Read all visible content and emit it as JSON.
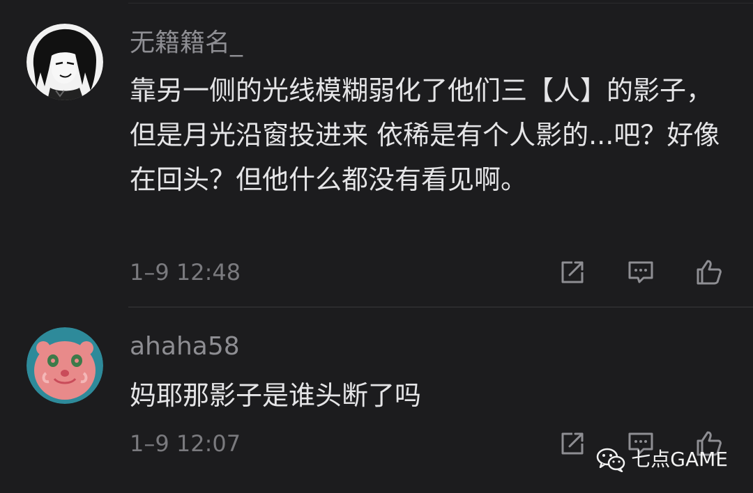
{
  "comments": [
    {
      "username": "无籍籍名_",
      "avatar_icon": "anime-character-avatar",
      "text": "靠另一侧的光线模糊弱化了他们三【人】的影子，但是月光沿窗投进来 依稀是有个人影的...吧？好像在回头？但他什么都没有看见啊。",
      "timestamp": "1–9 12:48",
      "actions": [
        "share-icon",
        "comment-icon",
        "thumbs-up-icon"
      ]
    },
    {
      "username": "ahaha58",
      "avatar_icon": "pink-bear-avatar",
      "text": "妈耶那影子是谁头断了吗",
      "timestamp": "1–9 12:07",
      "actions": [
        "share-icon",
        "comment-icon",
        "thumbs-up-icon"
      ]
    }
  ],
  "watermark": {
    "icon": "wechat-icon",
    "text": "七点GAME"
  },
  "colors": {
    "background": "#1c1c1e",
    "username": "#8e8e93",
    "body_text": "#e5e5e7",
    "timestamp": "#7a7a7e",
    "icon": "#8e8e93",
    "avatar_2_bg": "#2e8a9a",
    "avatar_2_face": "#e88a8a"
  }
}
